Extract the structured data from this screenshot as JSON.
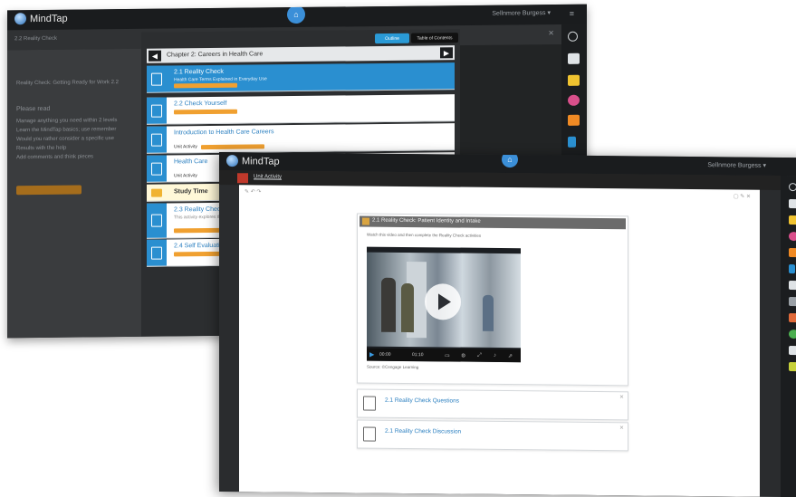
{
  "app": {
    "name": "MindTap"
  },
  "back_window": {
    "user_menu": "Sellnmore Burgess ▾",
    "top_icon": "⌂",
    "subbar_title": "2.2 Reality Check",
    "left_text": [
      "Reality Check: Getting Ready for Work 2.2",
      "Please read",
      "Manage anything you need within 2 levels",
      "Learn the MindTap basics; use remember",
      "Would you rather consider a specific use",
      "Results with the help",
      "Add comments and think pieces"
    ],
    "reader": {
      "pill_active": "Outline",
      "pill_other": "Table of Contents",
      "chapter": "Chapter 2: Careers in Health Care",
      "items": [
        {
          "title": "2.1 Reality Check",
          "subtitle": "Health Care Terms Explained in Everyday Use",
          "selected": true
        },
        {
          "title": "2.2 Check Yourself",
          "subtitle": "",
          "selected": false
        },
        {
          "title": "Introduction to Health Care Careers",
          "subtitle": "Unit Activity",
          "selected": false
        },
        {
          "title": "Health Care",
          "subtitle": "Unit Activity",
          "selected": false
        },
        {
          "title": "Study Time",
          "subtitle": "",
          "selected": false,
          "study": true
        },
        {
          "title": "2.3 Reality Check",
          "subtitle": "This activity explores the roles used in",
          "selected": false
        },
        {
          "title": "2.4 Self Evaluation",
          "subtitle": "",
          "selected": false
        }
      ]
    }
  },
  "front_window": {
    "user_menu": "Sellnmore Burgess ▾",
    "top_icon": "⌂",
    "breadcrumb": "Unit Activity",
    "card": {
      "title": "2.1 Reality Check: Patient Identity and Intake",
      "intro": "Watch this video and then complete the Reality Check activities",
      "video": {
        "elapsed": "00:00",
        "duration": "01:10"
      },
      "caption": "Source: ©Cengage Learning"
    },
    "links": [
      {
        "title": "2.1 Reality Check Questions"
      },
      {
        "title": "2.1 Reality Check Discussion"
      }
    ]
  },
  "colors": {
    "accent": "#2a8fd0",
    "dark": "#2a2c2e",
    "tag": "#f0a030"
  }
}
